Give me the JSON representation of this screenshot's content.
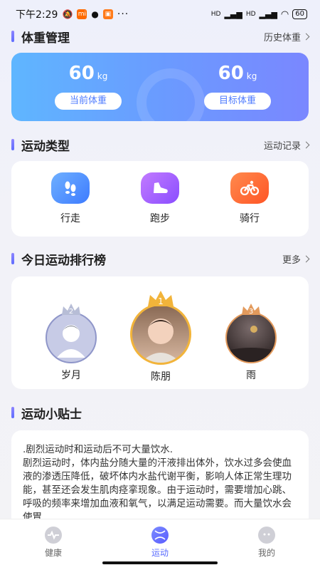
{
  "status_bar": {
    "time": "下午2:29",
    "dots": "···",
    "battery": "60",
    "network": "HD"
  },
  "weight": {
    "title": "体重管理",
    "history_link": "历史体重",
    "current": {
      "value": "60",
      "unit": "kg",
      "label": "当前体重"
    },
    "target": {
      "value": "60",
      "unit": "kg",
      "label": "目标体重"
    }
  },
  "sport_types": {
    "title": "运动类型",
    "record_link": "运动记录",
    "items": [
      {
        "label": "行走",
        "icon": "footprints-icon",
        "color": "#4b8dff"
      },
      {
        "label": "跑步",
        "icon": "running-shoe-icon",
        "color": "#a65cff"
      },
      {
        "label": "骑行",
        "icon": "bicycle-icon",
        "color": "#ff6a3d"
      }
    ]
  },
  "ranking": {
    "title": "今日运动排行榜",
    "more_link": "更多",
    "entries": [
      {
        "rank": "2",
        "name": "岁月"
      },
      {
        "rank": "1",
        "name": "陈朋"
      },
      {
        "rank": "3",
        "name": "雨"
      }
    ]
  },
  "tips": {
    "title": "运动小贴士",
    "text": ".剧烈运动时和运动后不可大量饮水.\n剧烈运动时，体内盐分随大量的汗液排出体外，饮水过多会使血液的渗透压降低，破坏体内水盐代谢平衡，影响人体正常生理功能，甚至还会发生肌肉痉挛现象。由于运动时，需要增加心跳、呼吸的频率来增加血液和氧气，以满足运动需要。而大量饮水会使胃"
  },
  "tabs": [
    {
      "label": "健康",
      "icon": "heartbeat-icon"
    },
    {
      "label": "运动",
      "icon": "sport-ball-icon",
      "active": true
    },
    {
      "label": "我的",
      "icon": "profile-face-icon"
    }
  ]
}
